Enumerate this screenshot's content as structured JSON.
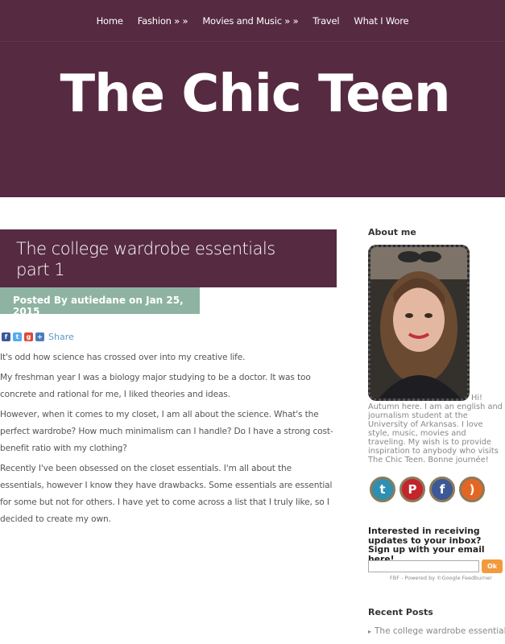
{
  "nav": {
    "items": [
      "Home",
      "Fashion » »",
      "Movies and Music » »",
      "Travel",
      "What I Wore"
    ]
  },
  "site": {
    "title": "The Chic Teen"
  },
  "post": {
    "title_line1": "The college wardrobe essentials",
    "title_line2": "part 1",
    "meta": "Posted By autiedane on Jan 25, 2015",
    "share_label": "Share",
    "paragraphs": [
      "It's odd how science has crossed over into my creative life.",
      "My freshman year I was a biology major studying to be a doctor. It was too concrete and rational for me, I liked theories and ideas.",
      "However, when it comes to my closet, I am all about the science. What's the perfect wardrobe? How much minimalism can I handle? Do I have a strong cost-benefit ratio with my clothing?",
      "Recently I've been obsessed on the closet essentials. I'm all about the essentials, however I know they have drawbacks. Some essentials are essential for some but not for others. I have yet to come across a list that I truly like, so I decided to create my own."
    ]
  },
  "sidebar": {
    "about_title": "About me",
    "about_hi": "Hi!",
    "about_text": "Autumn here. I am an english and journalism student at the University of Arkansas. I love style, music, movies and traveling. My wish is to provide inspiration to anybody who visits The Chic Teen. Bonne journée!",
    "subscribe_title": "Interested in receiving updates to your inbox? Sign up with your email here!",
    "email_placeholder": "",
    "ok_label": "Ok",
    "fbf_note": "FBF - Powered by ©Google Feedburner",
    "recent_title": "Recent Posts",
    "recent_item": "The college wardrobe essentials"
  },
  "colors": {
    "plum": "#562a40",
    "sage": "#8fb3a3",
    "orange": "#f29a3d"
  },
  "icons": [
    "facebook-icon",
    "twitter-icon",
    "google-plus-icon",
    "share-plus-icon",
    "twitter-circle-icon",
    "pinterest-circle-icon",
    "facebook-circle-icon",
    "rss-circle-icon"
  ]
}
